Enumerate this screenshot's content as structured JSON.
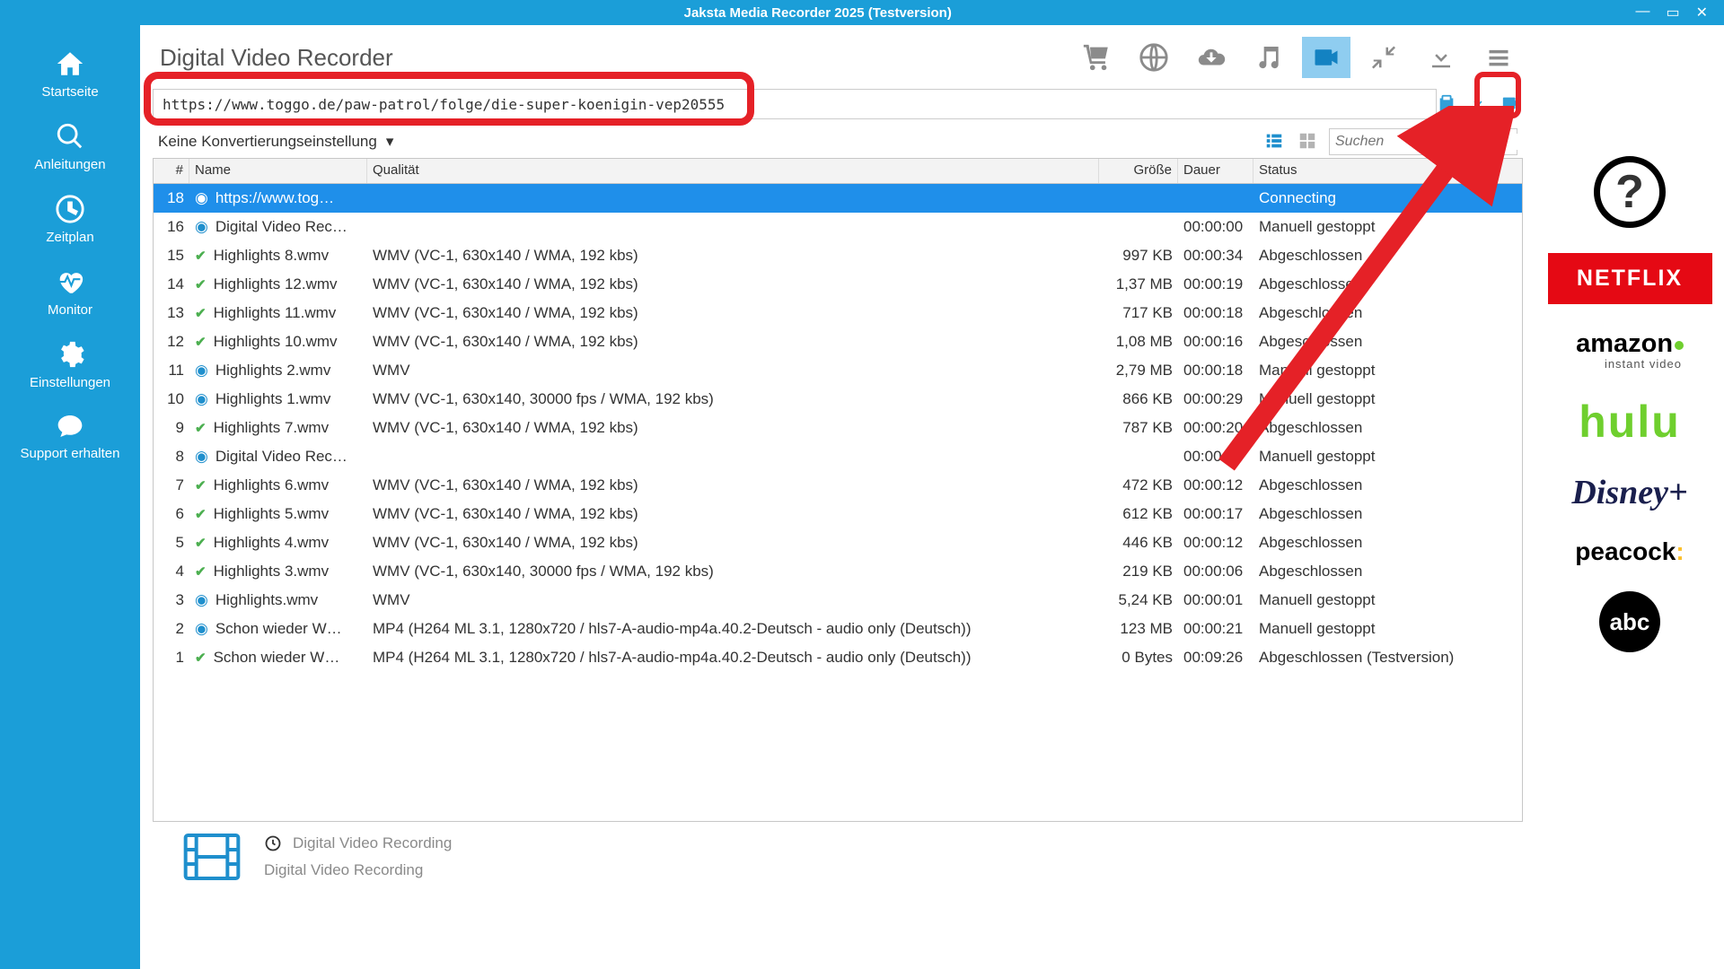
{
  "window": {
    "title": "Jaksta Media Recorder 2025 (Testversion)"
  },
  "sidebar": {
    "items": [
      {
        "label": "Startseite",
        "icon": "home"
      },
      {
        "label": "Anleitungen",
        "icon": "search"
      },
      {
        "label": "Zeitplan",
        "icon": "clock"
      },
      {
        "label": "Monitor",
        "icon": "heart"
      },
      {
        "label": "Einstellungen",
        "icon": "gear"
      },
      {
        "label": "Support erhalten",
        "icon": "chat"
      }
    ]
  },
  "page_title": "Digital Video Recorder",
  "url_input": "https://www.toggo.de/paw-patrol/folge/die-super-koenigin-vep20555",
  "conversion_setting": "Keine Konvertierungseinstellung",
  "search_placeholder": "Suchen",
  "table": {
    "headers": [
      "#",
      "Name",
      "Qualität",
      "Größe",
      "Dauer",
      "Status"
    ],
    "rows": [
      {
        "num": "18",
        "icon": "disc",
        "name": "https://www.tog…",
        "qual": "",
        "size": "",
        "dur": "",
        "status": "Connecting",
        "selected": true
      },
      {
        "num": "16",
        "icon": "disc",
        "name": "Digital Video Rec…",
        "qual": "",
        "size": "",
        "dur": "00:00:00",
        "status": "Manuell gestoppt"
      },
      {
        "num": "15",
        "icon": "tick",
        "name": "Highlights 8.wmv",
        "qual": "WMV (VC-1, 630x140 / WMA, 192 kbs)",
        "size": "997 KB",
        "dur": "00:00:34",
        "status": "Abgeschlossen"
      },
      {
        "num": "14",
        "icon": "tick",
        "name": "Highlights 12.wmv",
        "qual": "WMV (VC-1, 630x140 / WMA, 192 kbs)",
        "size": "1,37 MB",
        "dur": "00:00:19",
        "status": "Abgeschlossen"
      },
      {
        "num": "13",
        "icon": "tick",
        "name": "Highlights 11.wmv",
        "qual": "WMV (VC-1, 630x140 / WMA, 192 kbs)",
        "size": "717 KB",
        "dur": "00:00:18",
        "status": "Abgeschlossen"
      },
      {
        "num": "12",
        "icon": "tick",
        "name": "Highlights 10.wmv",
        "qual": "WMV (VC-1, 630x140 / WMA, 192 kbs)",
        "size": "1,08 MB",
        "dur": "00:00:16",
        "status": "Abgeschlossen"
      },
      {
        "num": "11",
        "icon": "disc",
        "name": "Highlights 2.wmv",
        "qual": "WMV",
        "size": "2,79 MB",
        "dur": "00:00:18",
        "status": "Manuell gestoppt"
      },
      {
        "num": "10",
        "icon": "disc",
        "name": "Highlights 1.wmv",
        "qual": "WMV (VC-1, 630x140, 30000 fps / WMA, 192 kbs)",
        "size": "866 KB",
        "dur": "00:00:29",
        "status": "Manuell gestoppt"
      },
      {
        "num": "9",
        "icon": "tick",
        "name": "Highlights 7.wmv",
        "qual": "WMV (VC-1, 630x140 / WMA, 192 kbs)",
        "size": "787 KB",
        "dur": "00:00:20",
        "status": "Abgeschlossen"
      },
      {
        "num": "8",
        "icon": "disc",
        "name": "Digital Video Rec…",
        "qual": "",
        "size": "",
        "dur": "00:00:00",
        "status": "Manuell gestoppt"
      },
      {
        "num": "7",
        "icon": "tick",
        "name": "Highlights 6.wmv",
        "qual": "WMV (VC-1, 630x140 / WMA, 192 kbs)",
        "size": "472 KB",
        "dur": "00:00:12",
        "status": "Abgeschlossen"
      },
      {
        "num": "6",
        "icon": "tick",
        "name": "Highlights 5.wmv",
        "qual": "WMV (VC-1, 630x140 / WMA, 192 kbs)",
        "size": "612 KB",
        "dur": "00:00:17",
        "status": "Abgeschlossen"
      },
      {
        "num": "5",
        "icon": "tick",
        "name": "Highlights 4.wmv",
        "qual": "WMV (VC-1, 630x140 / WMA, 192 kbs)",
        "size": "446 KB",
        "dur": "00:00:12",
        "status": "Abgeschlossen"
      },
      {
        "num": "4",
        "icon": "tick",
        "name": "Highlights 3.wmv",
        "qual": "WMV (VC-1, 630x140, 30000 fps / WMA, 192 kbs)",
        "size": "219 KB",
        "dur": "00:00:06",
        "status": "Abgeschlossen"
      },
      {
        "num": "3",
        "icon": "disc",
        "name": "Highlights.wmv",
        "qual": "WMV",
        "size": "5,24 KB",
        "dur": "00:00:01",
        "status": "Manuell gestoppt"
      },
      {
        "num": "2",
        "icon": "disc",
        "name": "Schon wieder W…",
        "qual": "MP4 (H264 ML 3.1, 1280x720 / hls7-A-audio-mp4a.40.2-Deutsch - audio only (Deutsch))",
        "size": "123 MB",
        "dur": "00:00:21",
        "status": "Manuell gestoppt"
      },
      {
        "num": "1",
        "icon": "tick",
        "name": "Schon wieder W…",
        "qual": "MP4 (H264 ML 3.1, 1280x720 / hls7-A-audio-mp4a.40.2-Deutsch - audio only (Deutsch))",
        "size": "0 Bytes",
        "dur": "00:09:26",
        "status": "Abgeschlossen (Testversion)"
      }
    ]
  },
  "footer": {
    "line1": "Digital Video Recording",
    "line2": "Digital Video Recording"
  },
  "logos": [
    "?",
    "NETFLIX",
    "amazon",
    "instant video",
    "hulu",
    "Disney+",
    "peacock",
    "abc"
  ]
}
